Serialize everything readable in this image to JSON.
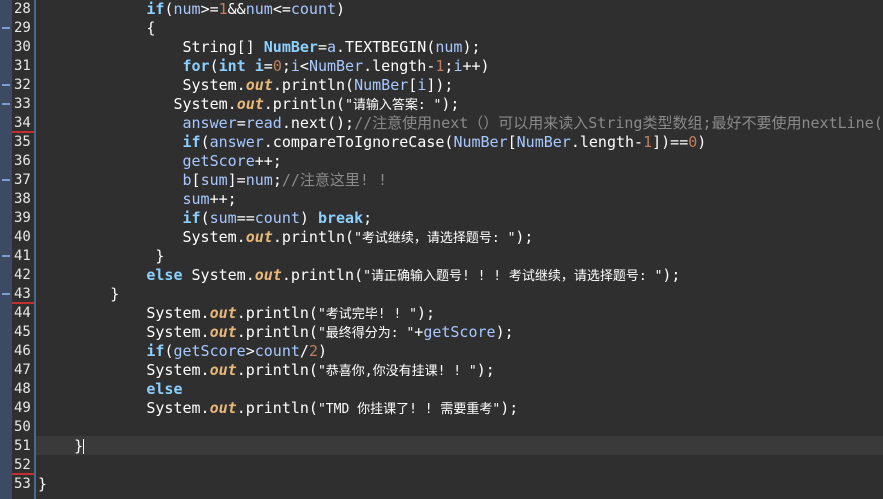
{
  "colors": {
    "background": "#2f2f2f",
    "keyword": "#8cd0ff",
    "variable": "#a8c8ff",
    "number": "#c08060",
    "static_field": "#e8b87a",
    "comment": "#8a8a8a",
    "text": "#ffffff",
    "gutter_marker": "#3c4a64"
  },
  "editor": {
    "lines": [
      {
        "n": "28",
        "tokens": [
          [
            "pad",
            "            "
          ],
          [
            "kw",
            "if"
          ],
          [
            "plain",
            "("
          ],
          [
            "var",
            "num"
          ],
          [
            "plain",
            ">="
          ],
          [
            "num",
            "1"
          ],
          [
            "plain",
            "&&"
          ],
          [
            "var",
            "num"
          ],
          [
            "plain",
            "<="
          ],
          [
            "var",
            "count"
          ],
          [
            "plain",
            ")"
          ]
        ]
      },
      {
        "n": "29",
        "tokens": [
          [
            "pad",
            "            "
          ],
          [
            "plain",
            "{"
          ]
        ]
      },
      {
        "n": "30",
        "tokens": [
          [
            "pad",
            "                "
          ],
          [
            "plain",
            "String[] "
          ],
          [
            "kw",
            "NumBer"
          ],
          [
            "plain",
            "="
          ],
          [
            "var",
            "a"
          ],
          [
            "plain",
            ".TEXTBEGIN("
          ],
          [
            "var",
            "num"
          ],
          [
            "plain",
            ");"
          ]
        ]
      },
      {
        "n": "31",
        "tokens": [
          [
            "pad",
            "                "
          ],
          [
            "kw",
            "for"
          ],
          [
            "plain",
            "("
          ],
          [
            "kw",
            "int"
          ],
          [
            "plain",
            " "
          ],
          [
            "kw",
            "i"
          ],
          [
            "plain",
            "="
          ],
          [
            "num",
            "0"
          ],
          [
            "plain",
            ";"
          ],
          [
            "var",
            "i"
          ],
          [
            "plain",
            "<"
          ],
          [
            "var",
            "NumBer"
          ],
          [
            "plain",
            ".length-"
          ],
          [
            "num",
            "1"
          ],
          [
            "plain",
            ";"
          ],
          [
            "var",
            "i"
          ],
          [
            "plain",
            "++)"
          ]
        ]
      },
      {
        "n": "32",
        "tokens": [
          [
            "pad",
            "                "
          ],
          [
            "plain",
            "System."
          ],
          [
            "fld",
            "out"
          ],
          [
            "plain",
            ".println("
          ],
          [
            "var",
            "NumBer"
          ],
          [
            "plain",
            "["
          ],
          [
            "var",
            "i"
          ],
          [
            "plain",
            "]);"
          ]
        ]
      },
      {
        "n": "33",
        "tokens": [
          [
            "pad",
            "               "
          ],
          [
            "plain",
            "System."
          ],
          [
            "fld",
            "out"
          ],
          [
            "plain",
            ".println("
          ],
          [
            "str",
            "\"请输入答案: \""
          ],
          [
            "plain",
            ");"
          ]
        ]
      },
      {
        "n": "34",
        "tokens": [
          [
            "pad",
            "                "
          ],
          [
            "var",
            "answer"
          ],
          [
            "plain",
            "="
          ],
          [
            "var",
            "read"
          ],
          [
            "plain",
            ".next();"
          ],
          [
            "cmt",
            "//注意使用next（）可以用来读入String类型数组;最好不要使用nextLine();"
          ]
        ]
      },
      {
        "n": "35",
        "tokens": [
          [
            "pad",
            "                "
          ],
          [
            "kw",
            "if"
          ],
          [
            "plain",
            "("
          ],
          [
            "var",
            "answer"
          ],
          [
            "plain",
            ".compareToIgnoreCase("
          ],
          [
            "var",
            "NumBer"
          ],
          [
            "plain",
            "["
          ],
          [
            "var",
            "NumBer"
          ],
          [
            "plain",
            ".length-"
          ],
          [
            "num",
            "1"
          ],
          [
            "plain",
            "])=="
          ],
          [
            "num",
            "0"
          ],
          [
            "plain",
            ")"
          ]
        ]
      },
      {
        "n": "36",
        "tokens": [
          [
            "pad",
            "                "
          ],
          [
            "var",
            "getScore"
          ],
          [
            "plain",
            "++;"
          ]
        ]
      },
      {
        "n": "37",
        "tokens": [
          [
            "pad",
            "                "
          ],
          [
            "var",
            "b"
          ],
          [
            "plain",
            "["
          ],
          [
            "var",
            "sum"
          ],
          [
            "plain",
            "]="
          ],
          [
            "var",
            "num"
          ],
          [
            "plain",
            ";"
          ],
          [
            "cmt",
            "//注意这里! !"
          ]
        ]
      },
      {
        "n": "38",
        "tokens": [
          [
            "pad",
            "                "
          ],
          [
            "var",
            "sum"
          ],
          [
            "plain",
            "++;"
          ]
        ]
      },
      {
        "n": "39",
        "tokens": [
          [
            "pad",
            "                "
          ],
          [
            "kw",
            "if"
          ],
          [
            "plain",
            "("
          ],
          [
            "var",
            "sum"
          ],
          [
            "plain",
            "=="
          ],
          [
            "var",
            "count"
          ],
          [
            "plain",
            ") "
          ],
          [
            "kw",
            "break"
          ],
          [
            "plain",
            ";"
          ]
        ]
      },
      {
        "n": "40",
        "tokens": [
          [
            "pad",
            "                "
          ],
          [
            "plain",
            "System."
          ],
          [
            "fld",
            "out"
          ],
          [
            "plain",
            ".println("
          ],
          [
            "str",
            "\"考试继续，请选择题号: \""
          ],
          [
            "plain",
            ");"
          ]
        ]
      },
      {
        "n": "41",
        "tokens": [
          [
            "pad",
            "             "
          ],
          [
            "plain",
            "}"
          ]
        ]
      },
      {
        "n": "42",
        "tokens": [
          [
            "pad",
            "            "
          ],
          [
            "kw",
            "else"
          ],
          [
            "plain",
            " System."
          ],
          [
            "fld",
            "out"
          ],
          [
            "plain",
            ".println("
          ],
          [
            "str",
            "\"请正确输入题号! ! ! 考试继续，请选择题号: \""
          ],
          [
            "plain",
            ");"
          ]
        ]
      },
      {
        "n": "43",
        "tokens": [
          [
            "pad",
            "        "
          ],
          [
            "plain",
            "}"
          ]
        ]
      },
      {
        "n": "44",
        "tokens": [
          [
            "pad",
            "            "
          ],
          [
            "plain",
            "System."
          ],
          [
            "fld",
            "out"
          ],
          [
            "plain",
            ".println("
          ],
          [
            "str",
            "\"考试完毕! ! \""
          ],
          [
            "plain",
            ");"
          ]
        ]
      },
      {
        "n": "45",
        "tokens": [
          [
            "pad",
            "            "
          ],
          [
            "plain",
            "System."
          ],
          [
            "fld",
            "out"
          ],
          [
            "plain",
            ".println("
          ],
          [
            "str",
            "\"最终得分为: \""
          ],
          [
            "plain",
            "+"
          ],
          [
            "var",
            "getScore"
          ],
          [
            "plain",
            ");"
          ]
        ]
      },
      {
        "n": "46",
        "tokens": [
          [
            "pad",
            "            "
          ],
          [
            "kw",
            "if"
          ],
          [
            "plain",
            "("
          ],
          [
            "var",
            "getScore"
          ],
          [
            "plain",
            ">"
          ],
          [
            "var",
            "count"
          ],
          [
            "plain",
            "/"
          ],
          [
            "num",
            "2"
          ],
          [
            "plain",
            ")"
          ]
        ]
      },
      {
        "n": "47",
        "tokens": [
          [
            "pad",
            "            "
          ],
          [
            "plain",
            "System."
          ],
          [
            "fld",
            "out"
          ],
          [
            "plain",
            ".println("
          ],
          [
            "str",
            "\"恭喜你,你没有挂课! ! \""
          ],
          [
            "plain",
            ");"
          ]
        ]
      },
      {
        "n": "48",
        "tokens": [
          [
            "pad",
            "            "
          ],
          [
            "kw",
            "else"
          ]
        ]
      },
      {
        "n": "49",
        "tokens": [
          [
            "pad",
            "            "
          ],
          [
            "plain",
            "System."
          ],
          [
            "fld",
            "out"
          ],
          [
            "plain",
            ".println("
          ],
          [
            "str",
            "\"TMD 你挂课了! ! 需要重考\""
          ],
          [
            "plain",
            ");"
          ]
        ]
      },
      {
        "n": "50",
        "tokens": []
      },
      {
        "n": "51",
        "tokens": [
          [
            "pad",
            "    "
          ],
          [
            "plain",
            "}"
          ]
        ]
      },
      {
        "n": "52",
        "tokens": []
      },
      {
        "n": "53",
        "tokens": [
          [
            "plain",
            "}"
          ]
        ]
      }
    ]
  }
}
